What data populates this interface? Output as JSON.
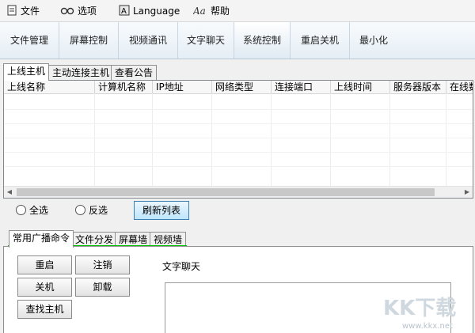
{
  "menubar": {
    "items": [
      {
        "label": "文件",
        "icon": "file-icon"
      },
      {
        "label": "选项",
        "icon": "glasses-icon"
      },
      {
        "label": "Language",
        "icon": "language-icon"
      },
      {
        "label": "帮助",
        "icon": "help-icon"
      }
    ]
  },
  "toolbar": {
    "buttons": [
      "文件管理",
      "屏幕控制",
      "视频通讯",
      "文字聊天",
      "系统控制",
      "重启关机",
      "最小化"
    ],
    "active": "系统控制"
  },
  "main_tabs": [
    "上线主机",
    "主动连接主机",
    "查看公告"
  ],
  "table": {
    "columns": [
      "上线名称",
      "计算机名称",
      "IP地址",
      "网络类型",
      "连接端口",
      "上线时间",
      "服务器版本",
      "在线数"
    ],
    "rows": []
  },
  "selection": {
    "select_all": "全选",
    "invert": "反选",
    "refresh": "刷新列表"
  },
  "sub_tabs": [
    "常用广播命令",
    "文件分发",
    "屏幕墙",
    "视频墙"
  ],
  "commands": {
    "restart": "重启",
    "logout": "注销",
    "shutdown": "关机",
    "uninstall": "卸载",
    "find_host": "查找主机"
  },
  "chat": {
    "label": "文字聊天"
  },
  "watermark": {
    "brand": "KK下载",
    "url": "www.kkx.net"
  },
  "colors": {
    "accent_blue": "#3c7fb1",
    "highlight_green": "#00c000",
    "watermark": "#cfd8df"
  }
}
